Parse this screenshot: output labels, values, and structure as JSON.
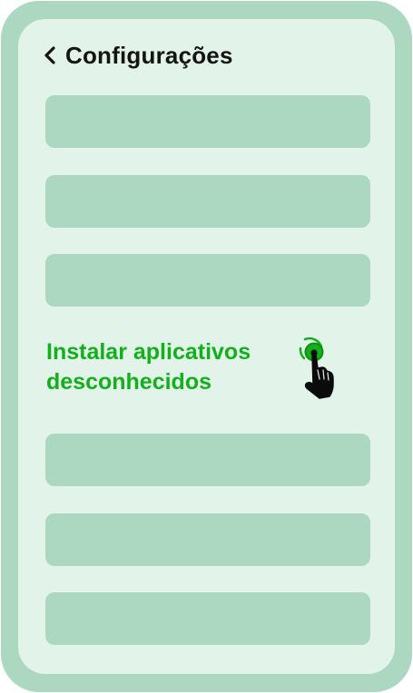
{
  "header": {
    "back_icon": "chevron-left-icon",
    "title": "Configurações"
  },
  "settings_list": {
    "highlighted_item": {
      "label": "Instalar aplicativos\ndesconhecidos",
      "color": "#13b01c"
    },
    "placeholder_rows_above": 3,
    "placeholder_rows_below": 3
  },
  "tap_indicator": {
    "icon": "hand-tap-icon",
    "color": "#13b01c"
  },
  "colors": {
    "phone_frame": "#acd8c1",
    "screen_background": "#e2f3e9",
    "placeholder_row": "#acd8c1",
    "title_text": "#141414"
  }
}
